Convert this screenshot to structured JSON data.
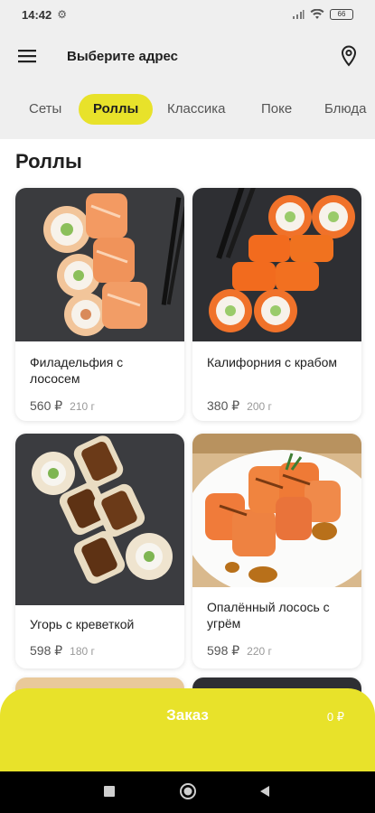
{
  "status": {
    "time": "14:42",
    "battery": "66"
  },
  "header": {
    "title": "Выберите адрес"
  },
  "tabs": [
    {
      "label": "Сеты",
      "active": false
    },
    {
      "label": "Роллы",
      "active": true
    },
    {
      "label": "Классика",
      "active": false
    },
    {
      "label": "Поке",
      "active": false
    },
    {
      "label": "Блюда",
      "active": false
    }
  ],
  "section": {
    "title": "Роллы"
  },
  "products": [
    {
      "name": "Филадельфия с лососем",
      "price": "560 ₽",
      "weight": "210 г"
    },
    {
      "name": "Калифорния с крабом",
      "price": "380 ₽",
      "weight": "200 г"
    },
    {
      "name": "Угорь с креветкой",
      "price": "598 ₽",
      "weight": "180 г"
    },
    {
      "name": "Опалённый лосось с угрём",
      "price": "598 ₽",
      "weight": "220 г"
    }
  ],
  "order": {
    "label": "Заказ",
    "total": "0 ₽"
  },
  "colors": {
    "accent": "#e8e22a",
    "header_bg": "#efefef"
  }
}
